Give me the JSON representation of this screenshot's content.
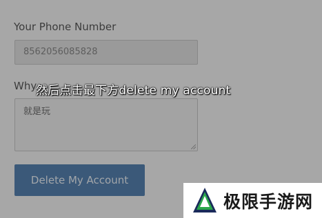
{
  "form": {
    "phone_label": "Your Phone Number",
    "phone_value": "8562056085828",
    "why_label": "Why",
    "reason_value": "就是玩",
    "delete_button_label": "Delete My Account"
  },
  "subtitle": "然后点击最下方delete my account",
  "watermark": {
    "text": "极限手游网",
    "logo": "triangle-logo-icon"
  },
  "colors": {
    "button": "#3b6fa6",
    "logo_green": "#2aa64a",
    "logo_dark": "#1a2a5a"
  }
}
